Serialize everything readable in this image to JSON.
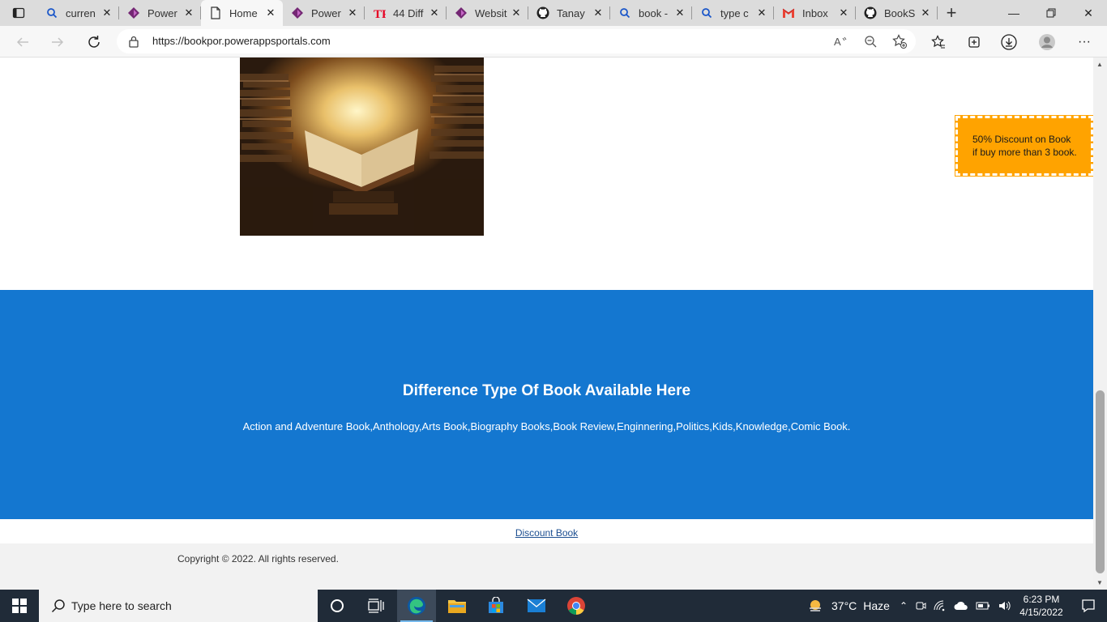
{
  "browser": {
    "tabs": [
      {
        "label": "curren",
        "icon": "search-icon",
        "active": false
      },
      {
        "label": "Power",
        "icon": "powerapps-icon",
        "active": false
      },
      {
        "label": "Home",
        "icon": "page-icon",
        "active": true
      },
      {
        "label": "Power",
        "icon": "powerapps-icon",
        "active": false
      },
      {
        "label": "44 Diff",
        "icon": "pinterest-icon",
        "active": false
      },
      {
        "label": "Websit",
        "icon": "powerapps-icon",
        "active": false
      },
      {
        "label": "Tanay",
        "icon": "github-icon",
        "active": false
      },
      {
        "label": "book -",
        "icon": "search-icon",
        "active": false
      },
      {
        "label": "type c",
        "icon": "search-icon",
        "active": false
      },
      {
        "label": "Inbox",
        "icon": "gmail-icon",
        "active": false
      },
      {
        "label": "BookS",
        "icon": "github-icon",
        "active": false
      }
    ],
    "url": "https://bookpor.powerappsportals.com"
  },
  "page": {
    "promo": {
      "line1": "50% Discount on Book",
      "line2": "if buy more than 3 book."
    },
    "banner": {
      "heading": "Difference Type Of Book Available Here",
      "text": "Action and Adventure Book,Anthology,Arts Book,Biography Books,Book Review,Enginnering,Politics,Kids,Knowledge,Comic Book."
    },
    "footer_link": "Discount Book",
    "copyright": "Copyright © 2022. All rights reserved."
  },
  "taskbar": {
    "search_placeholder": "Type here to search",
    "weather_temp": "37°C",
    "weather_desc": "Haze",
    "time": "6:23 PM",
    "date": "4/15/2022"
  }
}
